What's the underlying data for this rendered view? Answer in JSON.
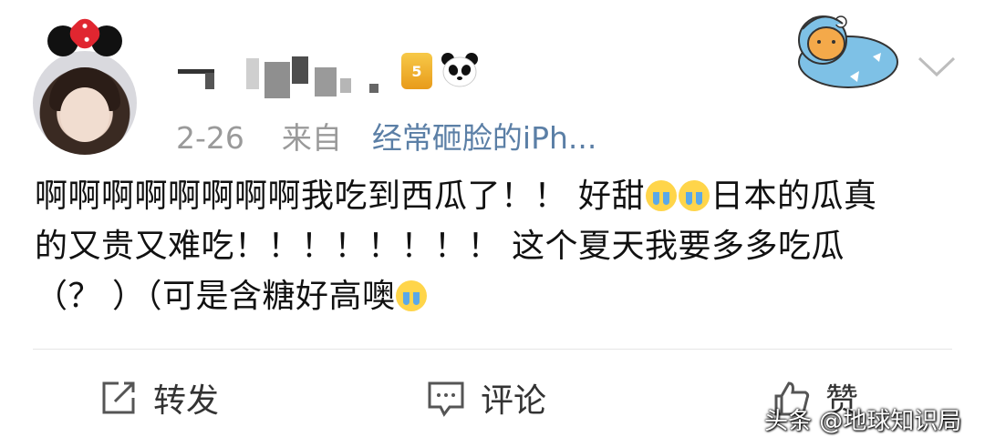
{
  "post": {
    "time": "2-26",
    "from_label": "来自",
    "source": "经常砸脸的iPh...",
    "content": {
      "line1_a": "啊啊啊啊啊啊啊啊我吃到西瓜了！！ 好甜",
      "line1_b": "日本的瓜真",
      "line2": "的又贵又难吃！！！！！！！！ 这个夏天我要多多吃瓜",
      "line3": "（？ ）（可是含糖好高噢"
    },
    "emoji_name": "crying-face-emoji"
  },
  "badges": {
    "vip_icon": "vip-badge-icon",
    "vip_text": "5",
    "panda_icon": "panda-icon"
  },
  "actions": {
    "repost_label": "转发",
    "comment_label": "评论",
    "like_label": "赞"
  },
  "watermark": "头条 @地球知识局",
  "colors": {
    "link": "#5b7fa6",
    "meta": "#9a9a9a",
    "divider": "#e6e6e6"
  }
}
